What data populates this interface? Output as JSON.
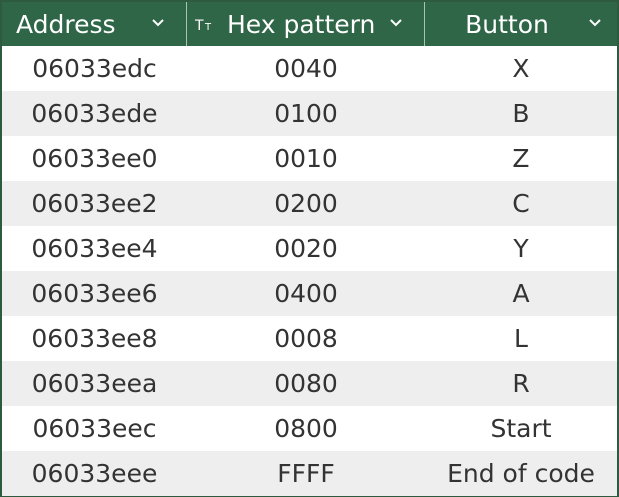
{
  "colors": {
    "header_bg": "#2f6647",
    "header_text": "#ffffff",
    "stripe": "#eeeeee",
    "cell_text": "#333333"
  },
  "table": {
    "columns": [
      {
        "label": "Address",
        "icon": "chevron-down-icon"
      },
      {
        "label": "Hex pattern",
        "type_icon": "text-type-icon",
        "icon": "chevron-down-icon"
      },
      {
        "label": "Button",
        "icon": "chevron-down-icon"
      }
    ],
    "rows": [
      {
        "address": "06033edc",
        "hex": "0040",
        "button": "X"
      },
      {
        "address": "06033ede",
        "hex": "0100",
        "button": "B"
      },
      {
        "address": "06033ee0",
        "hex": "0010",
        "button": "Z"
      },
      {
        "address": "06033ee2",
        "hex": "0200",
        "button": "C"
      },
      {
        "address": "06033ee4",
        "hex": "0020",
        "button": "Y"
      },
      {
        "address": "06033ee6",
        "hex": "0400",
        "button": "A"
      },
      {
        "address": "06033ee8",
        "hex": "0008",
        "button": "L"
      },
      {
        "address": "06033eea",
        "hex": "0080",
        "button": "R"
      },
      {
        "address": "06033eec",
        "hex": "0800",
        "button": "Start"
      },
      {
        "address": "06033eee",
        "hex": "FFFF",
        "button": "End of code"
      }
    ]
  }
}
